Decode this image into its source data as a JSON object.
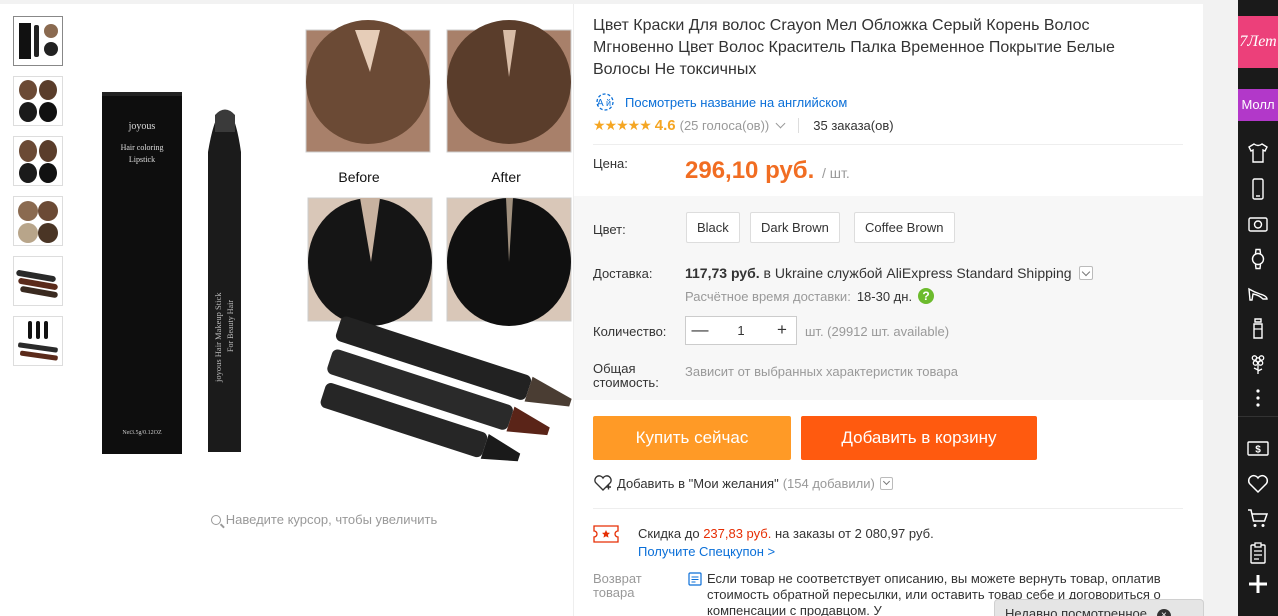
{
  "product": {
    "title": "Цвет Краски Для волос Crayon Мел Обложка Серый Корень Волос Мгновенно Цвет Волос Краситель Палка Временное Покрытие Белые Волосы Не токсичных",
    "translate_link": "Посмотреть название на английском",
    "rating": "4.6",
    "votes": "(25 голоса(ов))",
    "orders": "35 заказа(ов)",
    "stars": "★★★★★"
  },
  "gallery": {
    "zoom_hint": "Наведите курсор, чтобы увеличить",
    "before_label": "Before",
    "after_label": "After",
    "box_brand": "joyous",
    "box_line1": "Hair coloring",
    "box_line2": "Lipstick",
    "box_net": "Net3.5g/0.12OZ",
    "stick_text": "joyous Hair Makeup Stick",
    "stick_text2": "For Beauty Hair"
  },
  "price": {
    "label": "Цена:",
    "value": "296,10 руб.",
    "unit": "/ шт."
  },
  "color": {
    "label": "Цвет:",
    "options": [
      "Black",
      "Dark Brown",
      "Coffee Brown"
    ]
  },
  "shipping": {
    "label": "Доставка:",
    "cost": "117,73 руб.",
    "text_in": "в",
    "country": "Ukraine",
    "service_text": "службой AliExpress Standard Shipping",
    "eta_label": "Расчётное время доставки:",
    "eta_value": "18-30 дн."
  },
  "quantity": {
    "label": "Количество:",
    "minus": "—",
    "value": "1",
    "plus": "+",
    "available": "шт. (29912 шт. available)"
  },
  "total": {
    "label": "Общая стоимость:",
    "value": "Зависит от выбранных характеристик товара"
  },
  "buttons": {
    "buy_now": "Купить сейчас",
    "add_to_cart": "Добавить в корзину"
  },
  "wishlist": {
    "text": "Добавить в \"Мои желания\"",
    "count": "(154 добавили)"
  },
  "coupon": {
    "prefix": "Скидка до",
    "amount": "237,83 руб.",
    "suffix": "на заказы от 2 080,97 руб.",
    "link": "Получите Спецкупон >"
  },
  "returns": {
    "label": "Возврат товара",
    "text": "Если товар не соответствует описанию, вы можете вернуть товар, оплатив стоимость обратной пересылки, или оставить товар себе и договориться о компенсации с продавцом. У"
  },
  "recent": {
    "label": "Недавно посмотренное",
    "close": "×"
  },
  "sidebar": {
    "badge_7": "7Лет",
    "mall": "Молл",
    "icons": [
      "tshirt-icon",
      "phone-icon",
      "camera-icon",
      "watch-icon",
      "heel-shoe-icon",
      "bottle-icon",
      "flower-icon",
      "more-dots-icon",
      "dollar-card-icon",
      "heart-icon",
      "cart-icon",
      "clipboard-icon",
      "plus-icon"
    ]
  },
  "colors": {
    "orange_price": "#f16d22",
    "buy_now": "#ff9a26",
    "add_to_cart": "#ff5a0f",
    "link_blue": "#0a6fd8",
    "star": "#f5a623",
    "pink_badge": "#ec407a",
    "purple_mall": "#b238c9"
  }
}
